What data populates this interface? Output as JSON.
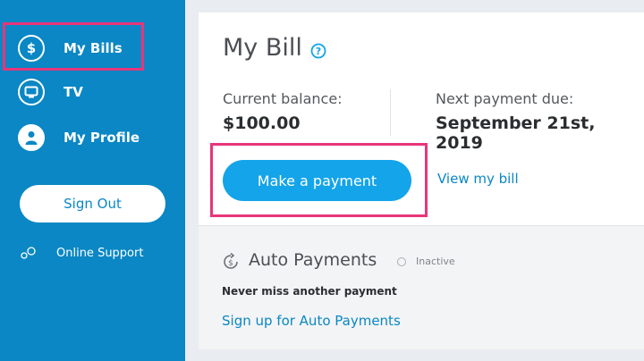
{
  "sidebar": {
    "items": [
      {
        "label": "My Bills",
        "icon": "dollar-icon"
      },
      {
        "label": "TV",
        "icon": "tv-icon"
      },
      {
        "label": "My Profile",
        "icon": "profile-icon"
      }
    ],
    "sign_out_label": "Sign Out",
    "support_label": "Online Support"
  },
  "bill": {
    "title": "My Bill",
    "balance_label": "Current balance:",
    "balance_value": "$100.00",
    "due_label": "Next payment due:",
    "due_value": "September 21st, 2019",
    "pay_button": "Make a payment",
    "view_link": "View my bill"
  },
  "auto_payments": {
    "title": "Auto Payments",
    "status": "Inactive",
    "description": "Never miss another payment",
    "link": "Sign up for Auto Payments"
  },
  "colors": {
    "sidebar": "#0a87c4",
    "button": "#14a4e9",
    "highlight": "#e8357a",
    "link": "#0a87c4"
  }
}
